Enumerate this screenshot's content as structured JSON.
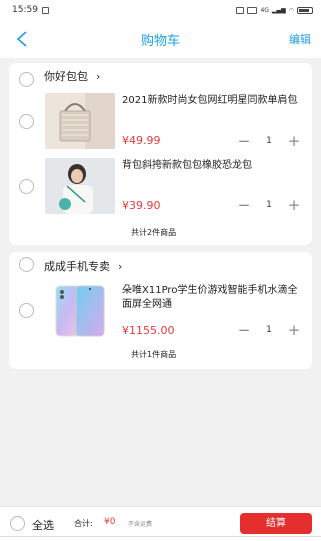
{
  "status_bar": {
    "time": "15:59",
    "net_speed": "4G"
  },
  "nav": {
    "title": "购物车",
    "edit_label": "编辑"
  },
  "shops": [
    {
      "name": "你好包包",
      "items": [
        {
          "name": "2021新款时尚女包网红明星同款单肩包",
          "price": "¥49.99",
          "quantity": "1"
        },
        {
          "name": "背包斜挎新款包包橡胶恐龙包",
          "price": "¥39.90",
          "quantity": "1"
        }
      ],
      "summary": "共计2件商品"
    },
    {
      "name": "成成手机专卖",
      "items": [
        {
          "name": "朵唯X11Pro学生价游戏智能手机水滴全面屏全网通",
          "price": "¥1155.00",
          "quantity": "1"
        }
      ],
      "summary": "共计1件商品"
    }
  ],
  "footer": {
    "select_all_label": "全选",
    "total_label": "合计:",
    "total_value": "¥0",
    "shipping_note": "不含运费",
    "checkout_label": "结算"
  },
  "colors": {
    "accent": "#1e9ee6",
    "price": "#e23b3b",
    "checkout": "#e52f2f"
  },
  "icons": [
    "back-arrow-icon",
    "chevron-right-icon",
    "minus-icon",
    "plus-icon",
    "battery-icon",
    "wifi-icon"
  ]
}
